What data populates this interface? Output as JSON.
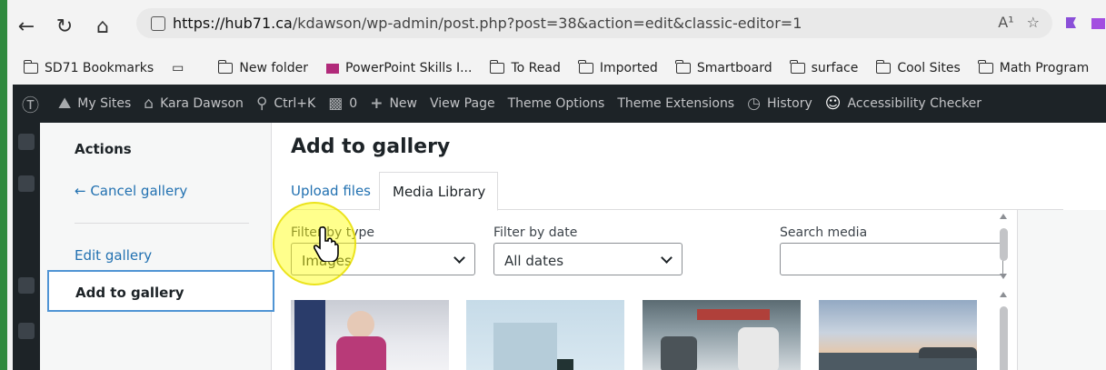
{
  "browser": {
    "url_host": "https://hub71.ca",
    "url_path": "/kdawson/wp-admin/post.php?post=38&action=edit&classic-editor=1",
    "read_aloud_icon": "A¹",
    "bookmarks": [
      {
        "label": "SD71 Bookmarks"
      },
      {
        "label": "New folder"
      },
      {
        "label": "PowerPoint Skills I..."
      },
      {
        "label": "To Read"
      },
      {
        "label": "Imported"
      },
      {
        "label": "Smartboard"
      },
      {
        "label": "surface"
      },
      {
        "label": "Cool Sites"
      },
      {
        "label": "Math Program"
      }
    ]
  },
  "adminbar": {
    "my_sites": "My Sites",
    "site_name": "Kara Dawson",
    "search": "Ctrl+K",
    "comments": "0",
    "new": "New",
    "view_page": "View Page",
    "theme_options": "Theme Options",
    "theme_extensions": "Theme Extensions",
    "history": "History",
    "accessibility": "Accessibility Checker"
  },
  "sidebar": {
    "heading": "Actions",
    "cancel": "← Cancel gallery",
    "edit": "Edit gallery",
    "add": "Add to gallery"
  },
  "main": {
    "title": "Add to gallery",
    "tab_upload": "Upload files",
    "tab_library": "Media Library",
    "filter_type_label": "Filter by type",
    "filter_type_value": "Images",
    "filter_date_label": "Filter by date",
    "filter_date_value": "All dates",
    "search_label": "Search media",
    "search_value": ""
  },
  "colors": {
    "accent": "#2271b1",
    "adminbar": "#1d2327",
    "highlight": "#ffff00"
  }
}
